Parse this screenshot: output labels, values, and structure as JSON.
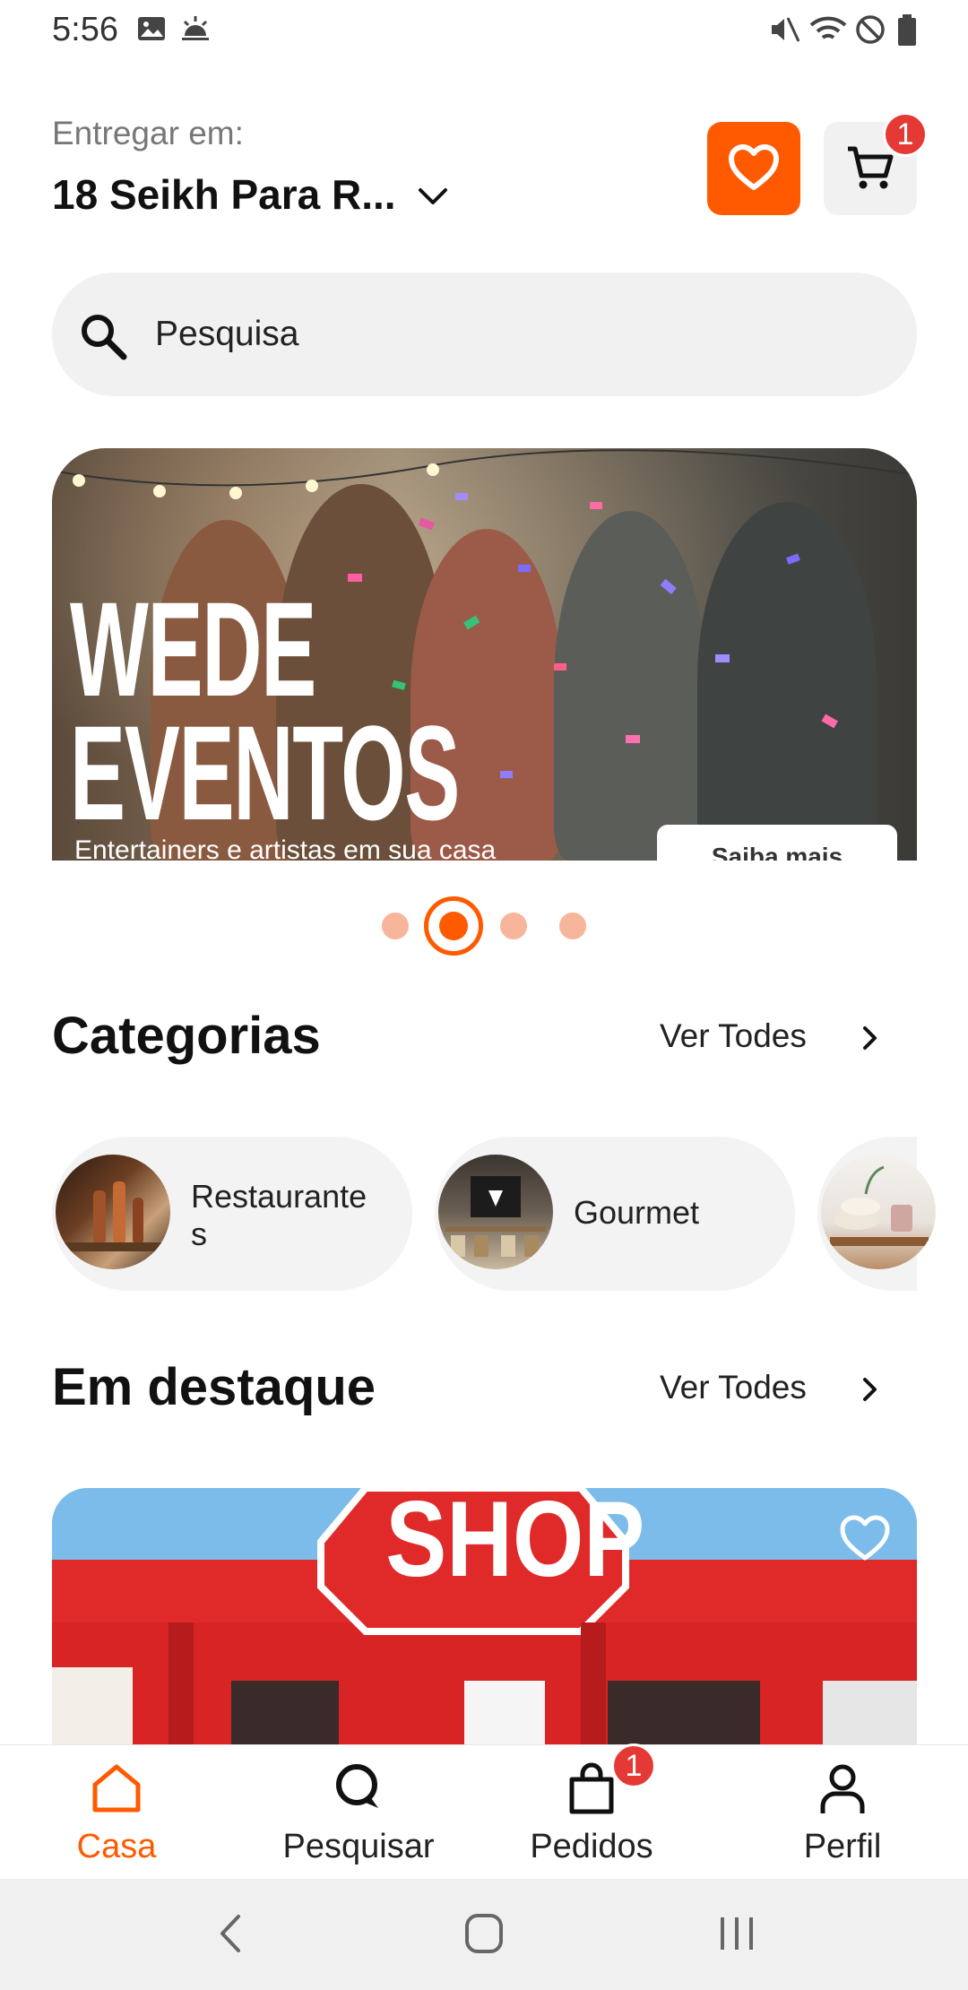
{
  "status_bar": {
    "time": "5:56"
  },
  "header": {
    "deliver_label": "Entregar em:",
    "address": "18 Seikh Para R...",
    "cart_count": "1"
  },
  "search": {
    "placeholder": "Pesquisa"
  },
  "banner": {
    "title_line1": "WEDE",
    "title_line2": "EVENTOS",
    "subtitle": "Entertainers e artistas em sua casa",
    "cta": "Saiba mais"
  },
  "carousel": {
    "active_index": 1,
    "count": 4
  },
  "categories": {
    "title": "Categorias",
    "see_all": "Ver Todes",
    "items": [
      {
        "label": "Restaurante\ns"
      },
      {
        "label": "Gourmet"
      }
    ]
  },
  "featured": {
    "title": "Em destaque",
    "see_all": "Ver Todes",
    "card_sign": "SHOP"
  },
  "bottom_nav": {
    "items": [
      {
        "label": "Casa",
        "icon": "home-icon",
        "active": true
      },
      {
        "label": "Pesquisar",
        "icon": "search-icon",
        "active": false
      },
      {
        "label": "Pedidos",
        "icon": "bag-icon",
        "active": false,
        "badge": "1"
      },
      {
        "label": "Perfil",
        "icon": "person-icon",
        "active": false
      }
    ]
  },
  "colors": {
    "accent": "#ff5a00",
    "badge": "#e53935",
    "pill": "#f3f3f3"
  }
}
